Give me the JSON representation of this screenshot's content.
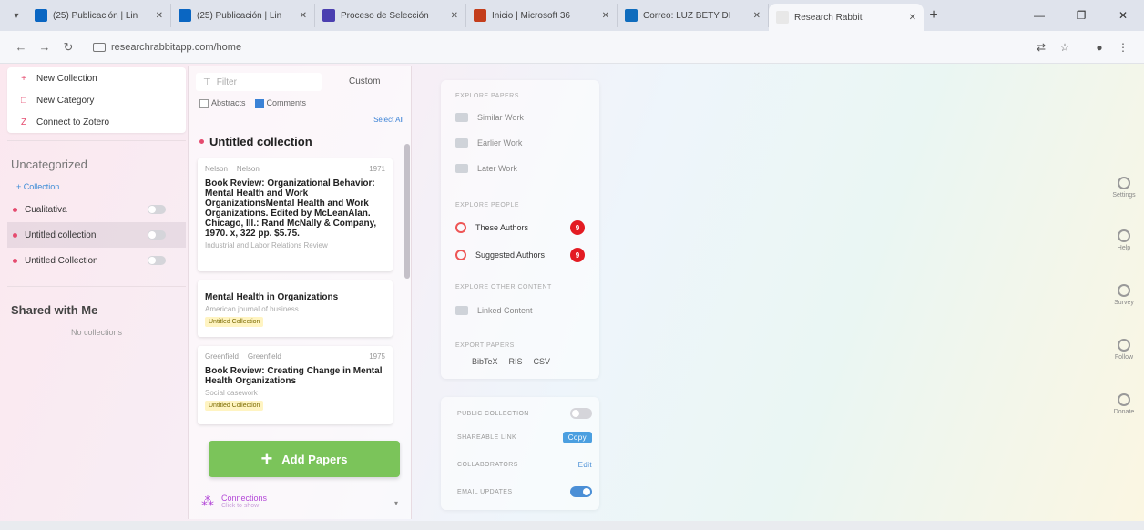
{
  "browser": {
    "tabs": [
      {
        "label": "(25) Publicación | Lin",
        "favicon_color": "#0a66c2"
      },
      {
        "label": "(25) Publicación | Lin",
        "favicon_color": "#0a66c2"
      },
      {
        "label": "Proceso de Selección",
        "favicon_color": "#4b3fb0"
      },
      {
        "label": "Inicio | Microsoft 36",
        "favicon_color": "#c43e1c"
      },
      {
        "label": "Correo: LUZ BETY DI",
        "favicon_color": "#0f6cbd"
      },
      {
        "label": "Research Rabbit",
        "favicon_color": "#e8e8e8",
        "active": true
      }
    ],
    "url": "researchrabbitapp.com/home"
  },
  "sidebar": {
    "menu": [
      "New Collection",
      "New Category",
      "Connect to Zotero"
    ],
    "uncategorized": "Uncategorized",
    "collection_sub": "+ Collection",
    "collections": [
      {
        "label": "Cualitativa"
      },
      {
        "label": "Untitled collection",
        "active": true
      },
      {
        "label": "Untitled Collection"
      }
    ],
    "shared_heading": "Shared with Me",
    "shared_empty": "No collections"
  },
  "middle": {
    "filter_placeholder": "Filter",
    "custom": "Custom",
    "abstracts": "Abstracts",
    "comments": "Comments",
    "select_all": "Select All",
    "collection_title": "Untitled collection",
    "papers": [
      {
        "authors": [
          "Nelson",
          "Nelson"
        ],
        "year": "1971",
        "title": "Book Review: Organizational Behavior: Mental Health and Work OrganizationsMental Health and Work Organizations. Edited by McLeanAlan. Chicago, Ill.: Rand McNally & Company, 1970. x, 322 pp. $5.75.",
        "journal": "Industrial and Labor Relations Review",
        "tag": ""
      },
      {
        "authors": [],
        "year": "",
        "title": "Mental Health in Organizations",
        "journal": "American journal of business",
        "tag": "Untitled Collection"
      },
      {
        "authors": [
          "Greenfield",
          "Greenfield"
        ],
        "year": "1975",
        "title": "Book Review: Creating Change in Mental Health Organizations",
        "journal": "Social casework",
        "tag": "Untitled Collection"
      }
    ],
    "add_papers": "Add Papers",
    "connections": "Connections",
    "connections_sub": "Click to show"
  },
  "explore": {
    "papers_heading": "EXPLORE PAPERS",
    "similar": "Similar Work",
    "earlier": "Earlier Work",
    "later": "Later Work",
    "people_heading": "EXPLORE PEOPLE",
    "these_authors": "These Authors",
    "these_count": "9",
    "suggested_authors": "Suggested Authors",
    "suggested_count": "9",
    "other_heading": "EXPLORE OTHER CONTENT",
    "linked": "Linked Content",
    "export_heading": "EXPORT PAPERS",
    "export_formats": [
      "BibTeX",
      "RIS",
      "CSV"
    ]
  },
  "settings": {
    "public_collection": "PUBLIC COLLECTION",
    "shareable_link": "SHAREABLE LINK",
    "copy": "Copy",
    "collaborators": "COLLABORATORS",
    "edit": "Edit",
    "email_updates": "EMAIL UPDATES",
    "public_on": false,
    "email_on": true
  },
  "rail": [
    "Settings",
    "Help",
    "Survey",
    "Follow",
    "Donate"
  ]
}
